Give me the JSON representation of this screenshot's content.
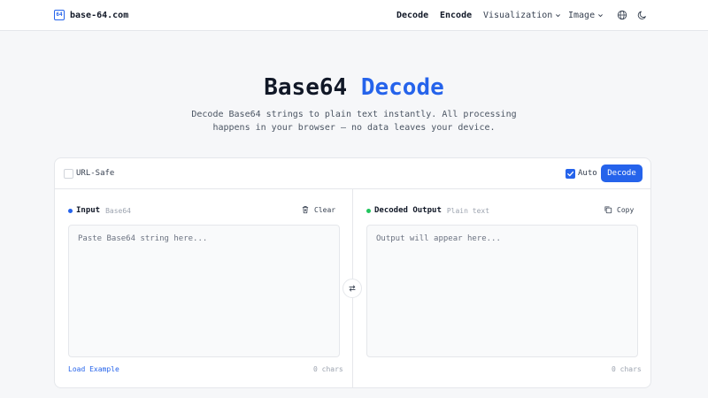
{
  "nav": {
    "logo_badge": "64",
    "logo_text": "base-64.com",
    "links": {
      "decode": "Decode",
      "encode": "Encode",
      "visualization": "Visualization",
      "image": "Image"
    }
  },
  "hero": {
    "title_main": "Base64",
    "title_accent": "Decode",
    "desc_line1": "Decode Base64 strings to plain text instantly. All processing",
    "desc_line2": "happens in your browser — no data leaves your device."
  },
  "toolbar": {
    "url_safe_label": "URL-Safe",
    "url_safe_checked": false,
    "auto_label": "Auto",
    "auto_checked": true,
    "decode_button": "Decode"
  },
  "input": {
    "title": "Input",
    "subtitle": "Base64",
    "action": "Clear",
    "placeholder": "Paste Base64 string here...",
    "value": "",
    "footer_link": "Load Example",
    "char_count": "0 chars"
  },
  "output": {
    "title": "Decoded Output",
    "subtitle": "Plain text",
    "action": "Copy",
    "placeholder": "Output will appear here...",
    "value": "",
    "char_count": "0 chars"
  },
  "colors": {
    "accent": "#2563eb",
    "input_dot": "#2563eb",
    "output_dot": "#22c55e"
  }
}
